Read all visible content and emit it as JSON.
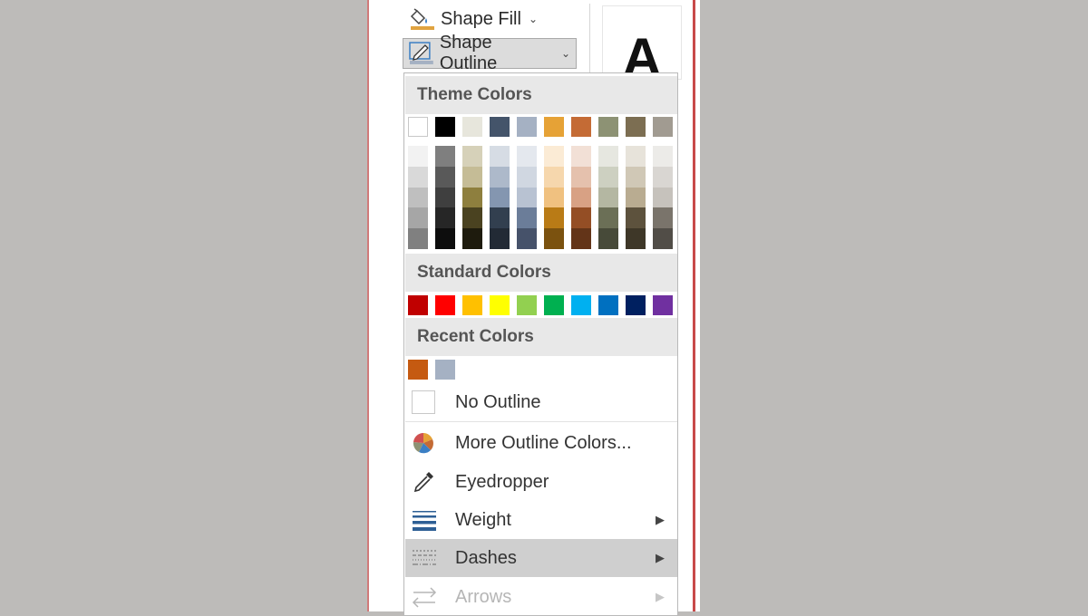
{
  "ribbon": {
    "shape_fill": {
      "label": "Shape Fill",
      "icon": "paint-bucket-icon"
    },
    "shape_outline": {
      "label": "Shape Outline",
      "icon": "pencil-outline-icon"
    },
    "preview_letter": "A"
  },
  "menu": {
    "theme_colors_header": "Theme Colors",
    "standard_colors_header": "Standard Colors",
    "recent_colors_header": "Recent Colors",
    "theme_colors": [
      {
        "base": "#ffffff",
        "tints": [
          "#f2f2f2",
          "#d9d9d9",
          "#bfbfbf",
          "#a6a6a6",
          "#808080"
        ]
      },
      {
        "base": "#000000",
        "tints": [
          "#7f7f7f",
          "#595959",
          "#3f3f3f",
          "#262626",
          "#0d0d0d"
        ]
      },
      {
        "base": "#e7e6dc",
        "tints": [
          "#d6d1b9",
          "#c5bc96",
          "#8e7f3e",
          "#4a4220",
          "#1e1b0d"
        ]
      },
      {
        "base": "#44546a",
        "tints": [
          "#d6dce4",
          "#adb9ca",
          "#8496b0",
          "#323f4f",
          "#222a35"
        ]
      },
      {
        "base": "#a5b1c3",
        "tints": [
          "#e4e8ee",
          "#d0d7e1",
          "#b8c2d2",
          "#6b7d99",
          "#46526a"
        ]
      },
      {
        "base": "#e6a236",
        "tints": [
          "#fbebd5",
          "#f6d7ad",
          "#f0c180",
          "#b97b16",
          "#7b520f"
        ]
      },
      {
        "base": "#c46b35",
        "tints": [
          "#f2e0d6",
          "#e5c1ad",
          "#d8a184",
          "#944e25",
          "#633418"
        ]
      },
      {
        "base": "#8d9274",
        "tints": [
          "#e6e7e0",
          "#cdd0c1",
          "#b4b7a2",
          "#6b6f56",
          "#474a39"
        ]
      },
      {
        "base": "#7c6e52",
        "tints": [
          "#e7e3da",
          "#d0c8b6",
          "#b9ac91",
          "#5d523d",
          "#3e3728"
        ]
      },
      {
        "base": "#a19b91",
        "tints": [
          "#ecebe8",
          "#d9d6d2",
          "#c6c2bc",
          "#7a746b",
          "#514d47"
        ]
      }
    ],
    "standard_colors": [
      "#c00000",
      "#ff0000",
      "#ffc000",
      "#ffff00",
      "#92d050",
      "#00b050",
      "#00b0f0",
      "#0070c0",
      "#002060",
      "#7030a0"
    ],
    "recent_colors": [
      "#c55a11",
      "#a5b1c3"
    ],
    "items": {
      "no_outline": {
        "label": "No Outline"
      },
      "more_colors": {
        "label": "More Outline Colors...",
        "icon": "color-wheel-icon"
      },
      "eyedropper": {
        "label": "Eyedropper",
        "icon": "eyedropper-icon"
      },
      "weight": {
        "label": "Weight",
        "icon": "line-weight-icon"
      },
      "dashes": {
        "label": "Dashes",
        "icon": "dashes-icon"
      },
      "arrows": {
        "label": "Arrows",
        "icon": "arrows-icon"
      }
    }
  }
}
